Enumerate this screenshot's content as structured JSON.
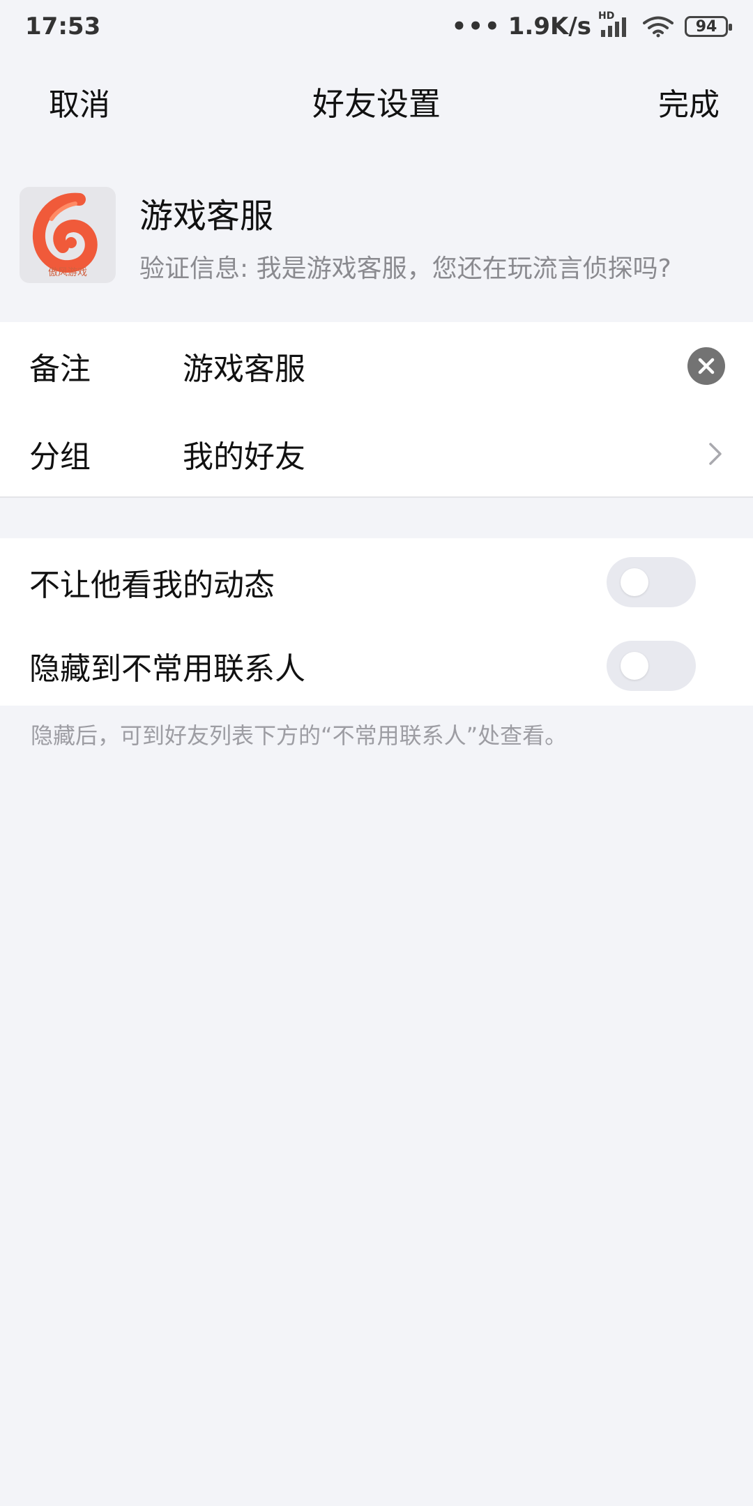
{
  "status_bar": {
    "time": "17:53",
    "network_speed": "1.9K/s",
    "hd_label": "HD",
    "battery": "94",
    "icons": [
      "dots-icon",
      "signal-icon",
      "wifi-icon",
      "battery-icon"
    ]
  },
  "nav": {
    "cancel_label": "取消",
    "title": "好友设置",
    "done_label": "完成"
  },
  "contact": {
    "name": "游戏客服",
    "verify_message": "验证信息: 我是游戏客服，您还在玩流言侦探吗?",
    "avatar_caption": "傲风游戏",
    "avatar_colors": {
      "orange": "#f05a3a",
      "light": "#ff8a65"
    }
  },
  "settings": {
    "remark_label": "备注",
    "remark_value": "游戏客服",
    "group_label": "分组",
    "group_value": "我的好友",
    "hide_moments_label": "不让他看我的动态",
    "hide_moments_on": false,
    "hide_contact_label": "隐藏到不常用联系人",
    "hide_contact_on": false
  },
  "hint": "隐藏后，可到好友列表下方的“不常用联系人”处查看。"
}
